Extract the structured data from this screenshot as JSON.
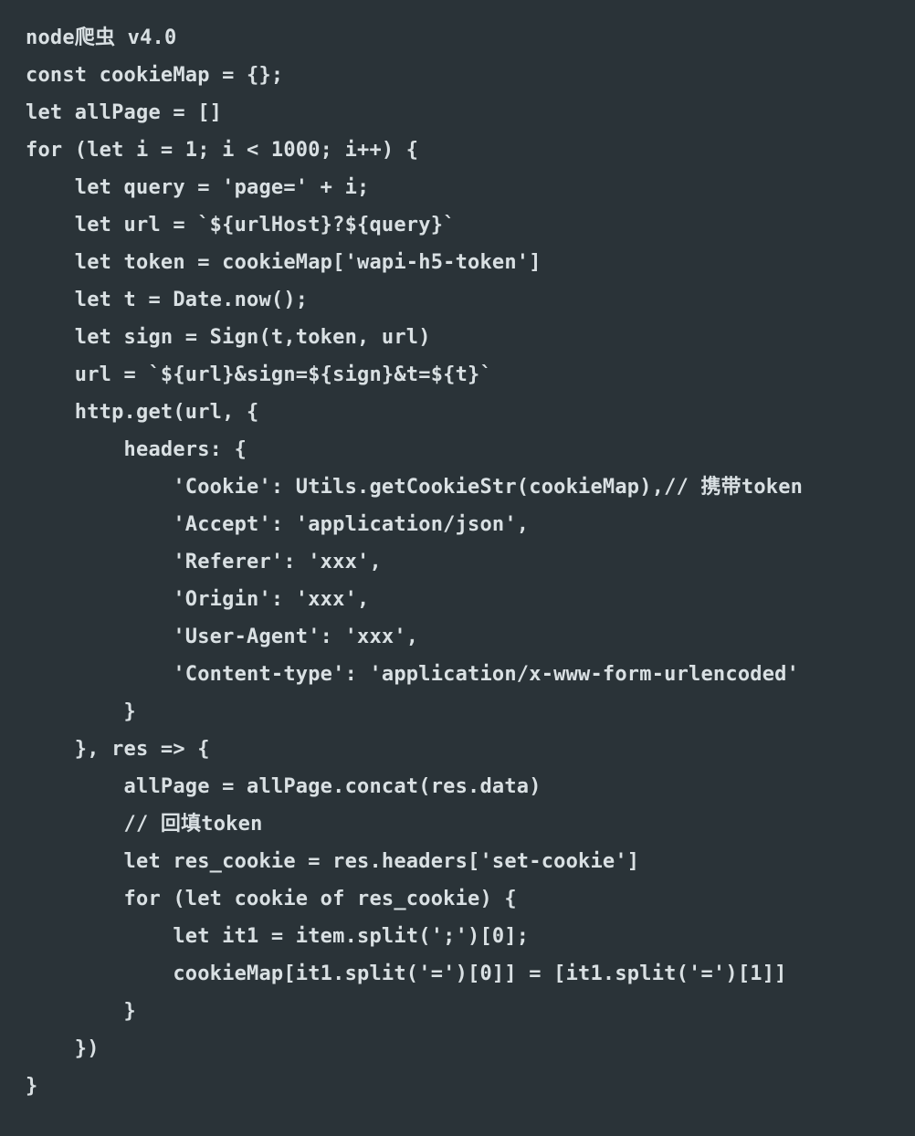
{
  "lines": [
    "node爬虫 v4.0",
    "const cookieMap = {};",
    "let allPage = []",
    "for (let i = 1; i < 1000; i++) {",
    "    let query = 'page=' + i;",
    "    let url = `${urlHost}?${query}`",
    "    let token = cookieMap['wapi-h5-token']",
    "    let t = Date.now();",
    "    let sign = Sign(t,token, url)",
    "    url = `${url}&sign=${sign}&t=${t}`",
    "    http.get(url, {",
    "        headers: {",
    "            'Cookie': Utils.getCookieStr(cookieMap),// 携带token",
    "            'Accept': 'application/json',",
    "            'Referer': 'xxx',",
    "            'Origin': 'xxx',",
    "            'User-Agent': 'xxx',",
    "            'Content-type': 'application/x-www-form-urlencoded'",
    "        }",
    "    }, res => {",
    "        allPage = allPage.concat(res.data)",
    "        // 回填token",
    "        let res_cookie = res.headers['set-cookie']",
    "        for (let cookie of res_cookie) {",
    "            let it1 = item.split(';')[0];",
    "            cookieMap[it1.split('=')[0]] = [it1.split('=')[1]]",
    "        }",
    "    })",
    "}"
  ]
}
